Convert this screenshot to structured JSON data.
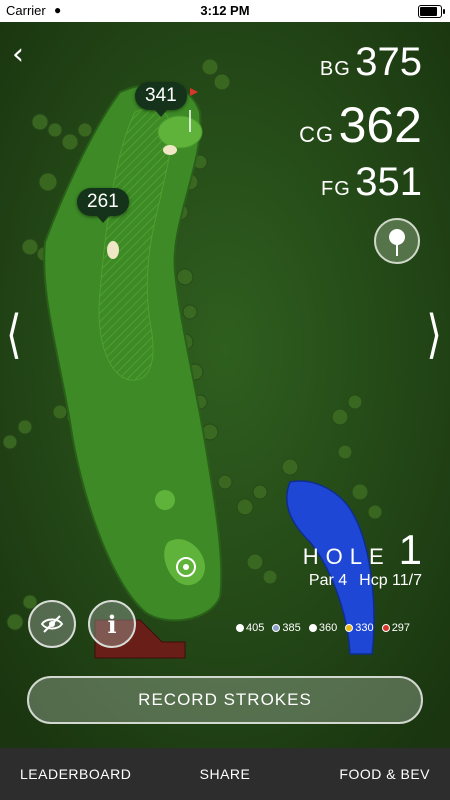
{
  "status_bar": {
    "carrier": "Carrier",
    "time": "3:12 PM"
  },
  "distances": {
    "back": {
      "label": "BG",
      "value": "375"
    },
    "center": {
      "label": "CG",
      "value": "362"
    },
    "front": {
      "label": "FG",
      "value": "351"
    }
  },
  "map_markers": {
    "marker_1": "341",
    "marker_2": "261"
  },
  "hole": {
    "label": "HOLE",
    "number": "1",
    "par": "Par 4",
    "handicap": "Hcp 11/7"
  },
  "tees": [
    {
      "yards": "405",
      "color": "#ffffff",
      "name": "white-tee"
    },
    {
      "yards": "385",
      "color": "#8aa0c8",
      "name": "blue-tee"
    },
    {
      "yards": "360",
      "color": "#ffffff",
      "name": "white-tee"
    },
    {
      "yards": "330",
      "color": "#e6b81e",
      "name": "gold-tee"
    },
    {
      "yards": "297",
      "color": "#d9362b",
      "name": "red-tee"
    }
  ],
  "actions": {
    "record_strokes": "RECORD STROKES"
  },
  "bottom_nav": {
    "leaderboard": "LEADERBOARD",
    "share": "SHARE",
    "food_bev": "FOOD & BEV"
  },
  "colors": {
    "rough": "#2c5a1c",
    "fairway": "#3a8a24",
    "green": "#5fb23a",
    "water": "#1f47d6",
    "bottom_bar": "#2d2d2d"
  }
}
